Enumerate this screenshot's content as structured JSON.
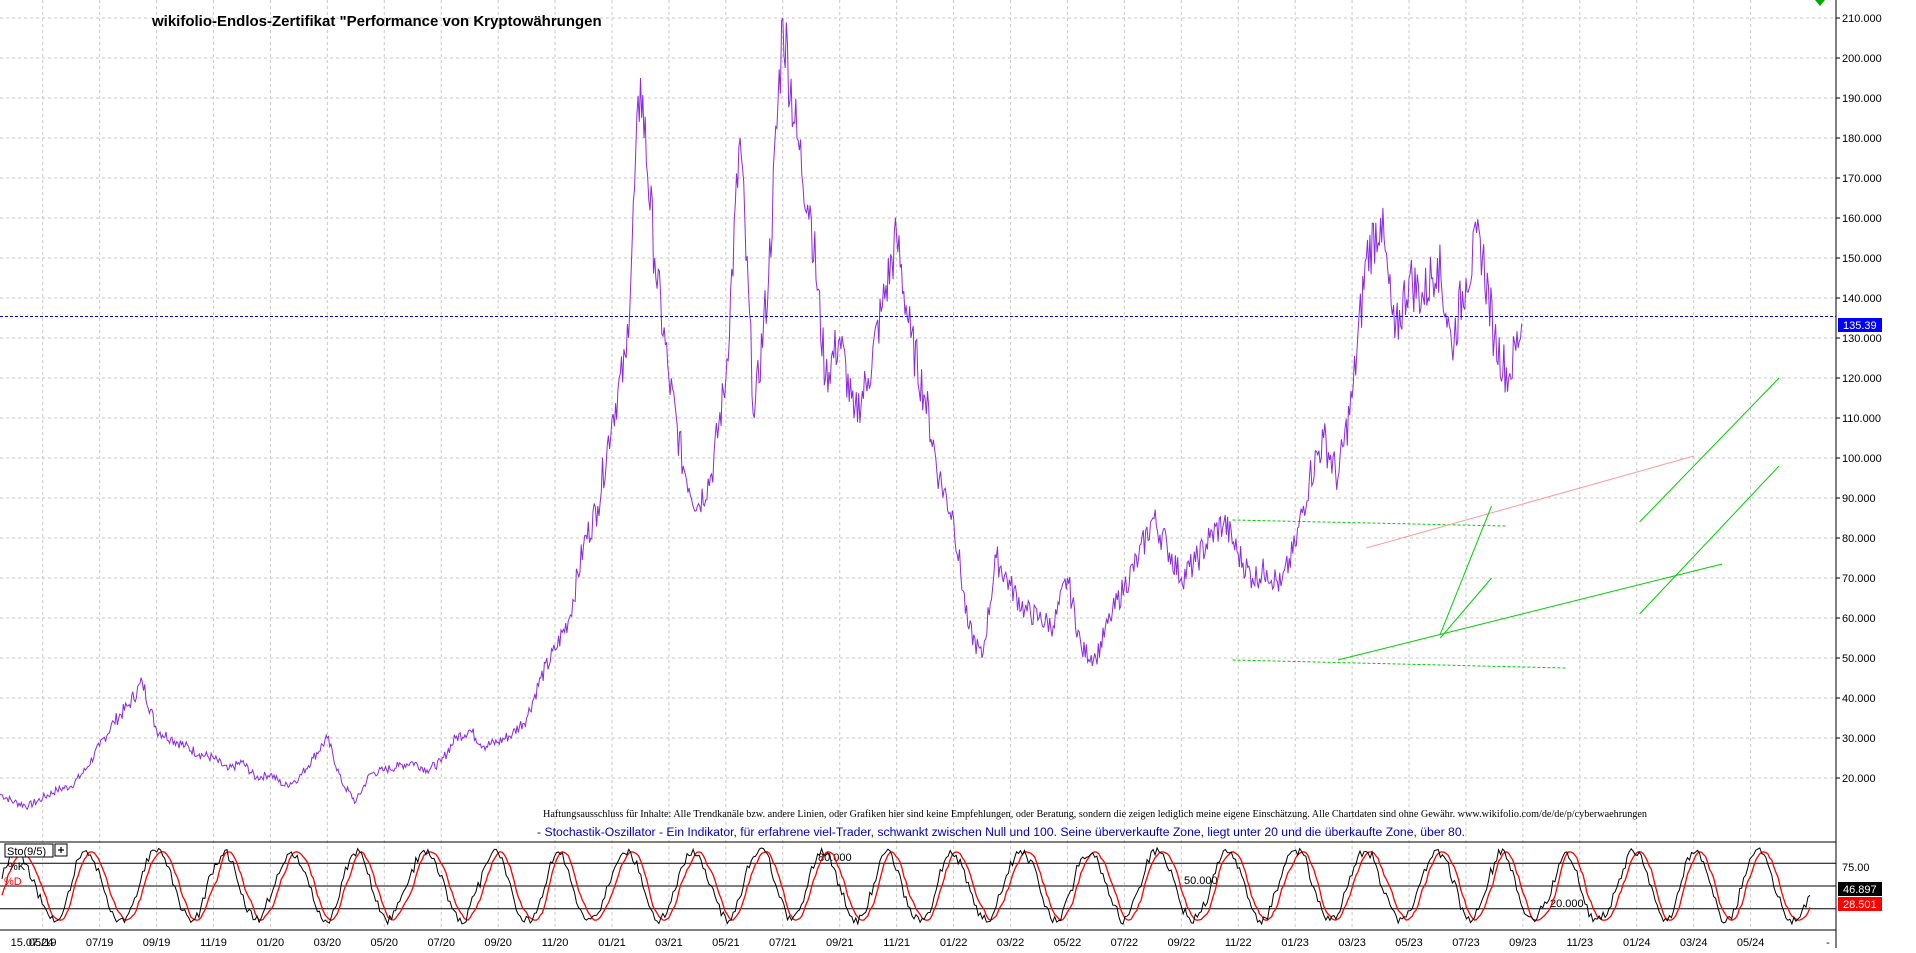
{
  "title": "wikifolio-Endlos-Zertifikat \"Performance von Kryptowährungen",
  "disclaimer": "Haftungsausschluss für Inhalte: Alle Trendkanäle bzw. andere Linien, oder Grafiken hier sind keine Empfehlungen, oder Beratung, sondern die zeigen lediglich meine eigene Einschätzung. Alle Chartdaten sind ohne Gewähr.  www.wikifolio.com/de/de/p/cyberwaehrungen",
  "indicator_note": "- Stochastik-Oszillator - Ein Indikator, für erfahrene viel-Trader, schwankt zwischen Null und 100. Seine überverkaufte Zone, liegt unter 20 und die überkaufte Zone, über 80.",
  "colors": {
    "price_line": "#8a2be2",
    "current_price": "#0000ff",
    "stoch_k": "#000000",
    "stoch_d": "#ff0000",
    "trend_green": "#00cc00",
    "trend_red": "#ff9999",
    "grid": "#c8c8c8"
  },
  "chart_data": [
    {
      "type": "line",
      "name": "price",
      "y_ticks": [
        "20.000",
        "30.000",
        "40.000",
        "50.000",
        "60.000",
        "70.000",
        "80.000",
        "90.000",
        "100.000",
        "110.000",
        "120.000",
        "130.000",
        "140.000",
        "150.000",
        "160.000",
        "170.000",
        "180.000",
        "190.000",
        "200.000",
        "210.000"
      ],
      "ylim": [
        8,
        213
      ],
      "current_value_label": "135.39",
      "current_value": 135.39,
      "x_labels": [
        "15.07.24",
        "05/19",
        "07/19",
        "09/19",
        "11/19",
        "01/20",
        "03/20",
        "05/20",
        "07/20",
        "09/20",
        "11/20",
        "01/21",
        "03/21",
        "05/21",
        "07/21",
        "09/21",
        "11/21",
        "01/22",
        "03/22",
        "05/22",
        "07/22",
        "09/22",
        "11/22",
        "01/23",
        "03/23",
        "05/23",
        "07/23",
        "09/23",
        "11/23",
        "01/24",
        "03/24",
        "05/24",
        "-"
      ],
      "x_month_index": [
        null,
        0,
        2,
        4,
        6,
        8,
        10,
        12,
        14,
        16,
        18,
        20,
        22,
        24,
        26,
        28,
        30,
        32,
        34,
        36,
        38,
        40,
        42,
        44,
        46,
        48,
        50,
        52,
        54,
        56,
        58,
        60,
        null
      ],
      "xlim": [
        -1.5,
        63
      ],
      "x": [
        -1.5,
        -1,
        -0.5,
        0,
        0.5,
        1,
        1.5,
        2,
        2.5,
        3,
        3.5,
        4,
        4.5,
        5,
        5.5,
        6,
        6.5,
        7,
        7.5,
        8,
        8.5,
        9,
        9.5,
        10,
        10.5,
        11,
        11.5,
        12,
        12.5,
        13,
        13.5,
        14,
        14.5,
        15,
        15.5,
        16,
        16.5,
        17,
        17.5,
        18,
        18.5,
        19,
        19.5,
        20,
        20.5,
        21,
        21.5,
        22,
        22.5,
        23,
        23.5,
        24,
        24.5,
        25,
        25.5,
        26,
        26.5,
        27,
        27.5,
        28,
        28.5,
        29,
        29.5,
        30,
        30.5,
        31,
        31.5,
        32,
        32.5,
        33,
        33.5,
        34,
        34.5,
        35,
        35.5,
        36,
        36.5,
        37,
        37.5,
        38,
        38.5,
        39,
        39.5,
        40,
        40.5,
        41,
        41.5,
        42,
        42.5,
        43,
        43.5,
        44,
        44.5,
        45,
        45.5,
        46,
        46.5,
        47,
        47.5,
        48,
        48.5,
        49,
        49.5,
        50,
        50.5,
        51,
        51.5,
        52,
        52.5,
        53,
        53.5,
        54,
        54.5,
        55,
        55.5,
        56,
        56.5,
        57,
        57.5,
        58,
        58.5,
        59,
        59.5,
        60,
        60.5,
        61,
        61.5,
        62
      ],
      "values": [
        16,
        14,
        13,
        15,
        17,
        18,
        22,
        28,
        34,
        38,
        44,
        32,
        30,
        28,
        26,
        25,
        22,
        24,
        20,
        21,
        18,
        20,
        25,
        30,
        19,
        14,
        21,
        22,
        23,
        24,
        22,
        24,
        30,
        32,
        28,
        29,
        31,
        35,
        45,
        52,
        60,
        78,
        88,
        110,
        125,
        195,
        150,
        120,
        98,
        88,
        96,
        120,
        180,
        110,
        145,
        210,
        180,
        160,
        120,
        130,
        110,
        120,
        138,
        155,
        130,
        115,
        95,
        85,
        58,
        50,
        75,
        68,
        62,
        60,
        58,
        70,
        52,
        50,
        60,
        68,
        75,
        85,
        78,
        70,
        74,
        80,
        84,
        76,
        70,
        72,
        68,
        78,
        95,
        105,
        95,
        115,
        150,
        160,
        130,
        145,
        140,
        150,
        128,
        145,
        155,
        130,
        120,
        135
      ],
      "annotations": [
        {
          "text": "80.000"
        },
        {
          "text": "50.000"
        },
        {
          "text": "20.000"
        }
      ]
    },
    {
      "type": "line",
      "name": "Sto(9/5)",
      "series": [
        {
          "name": "%K"
        },
        {
          "name": "%D"
        }
      ],
      "y_ticks": [
        "75.00"
      ],
      "ylim": [
        0,
        100
      ],
      "k_label": "46.897",
      "k_value": 46.897,
      "d_label": "28.501",
      "d_value": 28.501
    }
  ]
}
